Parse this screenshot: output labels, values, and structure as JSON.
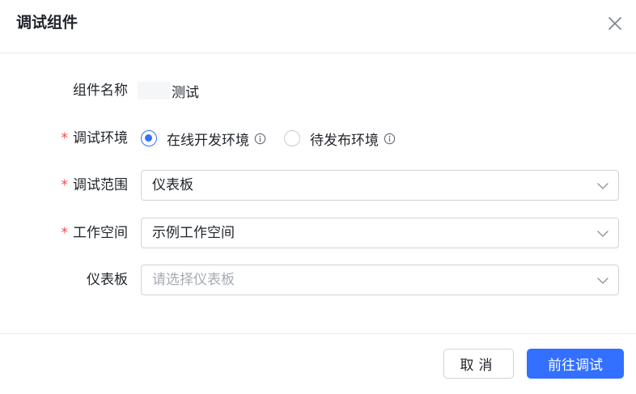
{
  "dialog": {
    "title": "调试组件"
  },
  "form": {
    "component_name": {
      "label": "组件名称",
      "value": "测试"
    },
    "environment": {
      "label": "调试环境",
      "required": "*",
      "options": [
        {
          "label": "在线开发环境",
          "checked": true
        },
        {
          "label": "待发布环境",
          "checked": false
        }
      ]
    },
    "scope": {
      "label": "调试范围",
      "required": "*",
      "value": "仪表板"
    },
    "workspace": {
      "label": "工作空间",
      "required": "*",
      "value": "示例工作空间"
    },
    "dashboard": {
      "label": "仪表板",
      "placeholder": "请选择仪表板"
    }
  },
  "footer": {
    "cancel_label": "取消",
    "submit_label": "前往调试"
  },
  "colors": {
    "primary": "#3370ff",
    "required": "#f54a45",
    "border": "#d0d3d6",
    "placeholder": "#a6abb3"
  },
  "icons": {
    "close": "close-icon",
    "info": "info-icon",
    "chevron": "chevron-down-icon"
  }
}
